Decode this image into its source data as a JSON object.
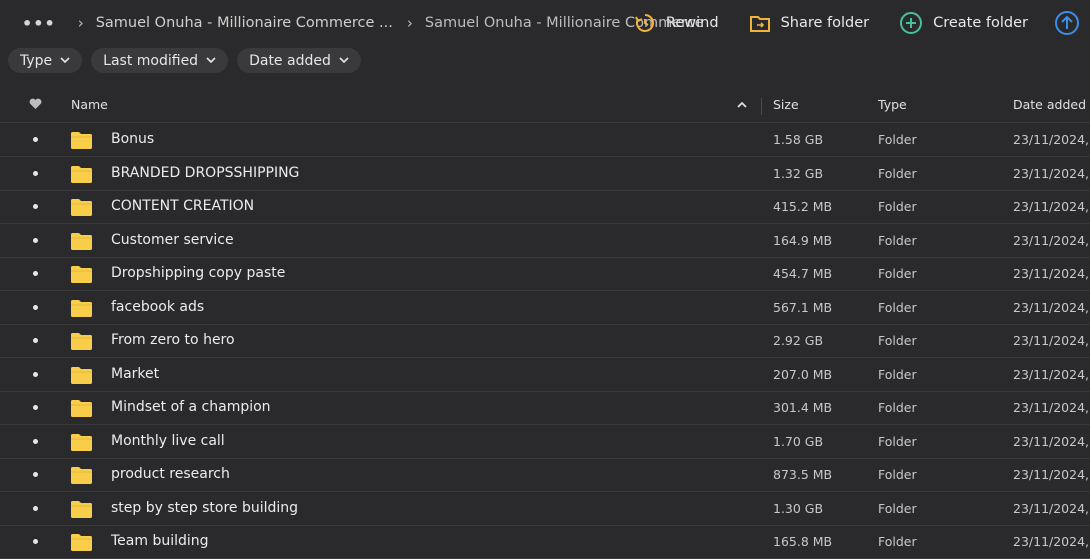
{
  "breadcrumb": {
    "more": "•••",
    "items": [
      "Samuel Onuha - Millionaire Commerce ...",
      "Samuel Onuha - Millionaire Commerce"
    ]
  },
  "toolbar": {
    "rewind": "Rewind",
    "share": "Share folder",
    "create": "Create folder"
  },
  "filters": [
    "Type",
    "Last modified",
    "Date added"
  ],
  "columns": {
    "name": "Name",
    "size": "Size",
    "type": "Type",
    "date": "Date added"
  },
  "colors": {
    "accent_teal": "#45c29a",
    "folder_yellow": "#f7cd4a",
    "upload_blue": "#3a8fe6"
  },
  "rows": [
    {
      "name": "Bonus",
      "size": "1.58 GB",
      "type": "Folder",
      "date": "23/11/2024,"
    },
    {
      "name": "BRANDED DROPSSHIPPING",
      "size": "1.32 GB",
      "type": "Folder",
      "date": "23/11/2024,"
    },
    {
      "name": "CONTENT CREATION",
      "size": "415.2 MB",
      "type": "Folder",
      "date": "23/11/2024,"
    },
    {
      "name": "Customer service",
      "size": "164.9 MB",
      "type": "Folder",
      "date": "23/11/2024,"
    },
    {
      "name": "Dropshipping copy paste",
      "size": "454.7 MB",
      "type": "Folder",
      "date": "23/11/2024,"
    },
    {
      "name": "facebook ads",
      "size": "567.1 MB",
      "type": "Folder",
      "date": "23/11/2024,"
    },
    {
      "name": "From zero to hero",
      "size": "2.92 GB",
      "type": "Folder",
      "date": "23/11/2024,"
    },
    {
      "name": "Market",
      "size": "207.0 MB",
      "type": "Folder",
      "date": "23/11/2024,"
    },
    {
      "name": "Mindset of a champion",
      "size": "301.4 MB",
      "type": "Folder",
      "date": "23/11/2024,"
    },
    {
      "name": "Monthly live call",
      "size": "1.70 GB",
      "type": "Folder",
      "date": "23/11/2024,"
    },
    {
      "name": "product research",
      "size": "873.5 MB",
      "type": "Folder",
      "date": "23/11/2024,"
    },
    {
      "name": "step by step store building",
      "size": "1.30 GB",
      "type": "Folder",
      "date": "23/11/2024,"
    },
    {
      "name": "Team building",
      "size": "165.8 MB",
      "type": "Folder",
      "date": "23/11/2024,"
    }
  ]
}
